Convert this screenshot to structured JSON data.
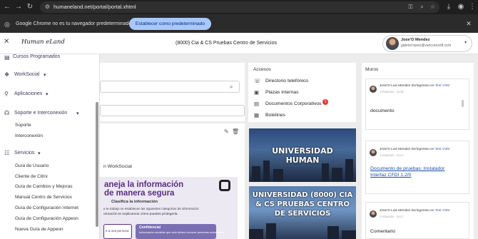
{
  "browser": {
    "url": "humaneland.net/portal/portal.xhtml",
    "infobar_message": "Google Chrome no es tu navegador predeterminado",
    "infobar_button": "Establecer como predeterminado"
  },
  "header": {
    "logo_text": "Human eLand",
    "title": "(8000) Cia & CS Pruebas Centro de Servicios",
    "user_name": "Jose'O Mendez",
    "user_email": "gabriel.lopez@vancuresoft.com"
  },
  "sidebar": {
    "top_item": "Cursos Programados",
    "worksocial": "WorkSocial",
    "aplicaciones": "Aplicaciones",
    "soporte": "Soporte e Interconexión",
    "soporte_items": [
      "Soporte",
      "Interconexión"
    ],
    "servicios": "Servicios",
    "servicios_items": [
      "Guía de Usuario",
      "Cliente de Citrix",
      "Guía de Cambios y Mejoras",
      "Manual Centro de Servicios",
      "Guía de Configuración Internet",
      "Guía de Configuración Appeon",
      "Nueva Guía de Appeon"
    ]
  },
  "left_panel": {
    "worksocial_text": "n WorkSocial",
    "banner_line1": "aneja la información",
    "banner_line2": "de manera segura",
    "banner_sub": "Clasifica la información",
    "banner_small": "e te trabajo se establecen las siguientes categorías de información:",
    "banner_small2": "ormación te explicamos cómo puedes protegerla.",
    "card1_text": "e a una persona",
    "card2_title": "Confidencial",
    "card2_text": "Información sensible que solo deben conocer personas autorizadas"
  },
  "accesos": {
    "title": "Accesos",
    "items": [
      "Directorio telefónico",
      "Plazas internas",
      "Documentos Corporativos",
      "Boletines"
    ],
    "badge": "1"
  },
  "images": {
    "img1_line1": "UNIVERSIDAD",
    "img1_line2": "HUMAN",
    "img2_line1": "UNIVERSIDAD (8000) CIA",
    "img2_line2": "& CS PRUEBAS CENTRO",
    "img2_line3": "DE SERVICIOS"
  },
  "muros": {
    "title": "Muros",
    "posts": [
      {
        "author": "Jose'O Luis Mendez Da'ingresso en",
        "target": "Test VSM",
        "date": "17/05/2024 · 10:36",
        "text": "documento"
      },
      {
        "author": "Jose'O Luis Mendez Da'ingresso en",
        "target": "Test VSM",
        "date": "17/05/2024 · 10:27",
        "link1": "Documento de pruebas: Instalador",
        "link2": "Interfaz CFDI 1.2/0"
      },
      {
        "author": "Jose'O Luis Mendez Da'ingresso en",
        "target": "Test VSM",
        "date": "17/05/2024 · 10:27",
        "text": "Comentario"
      }
    ]
  }
}
